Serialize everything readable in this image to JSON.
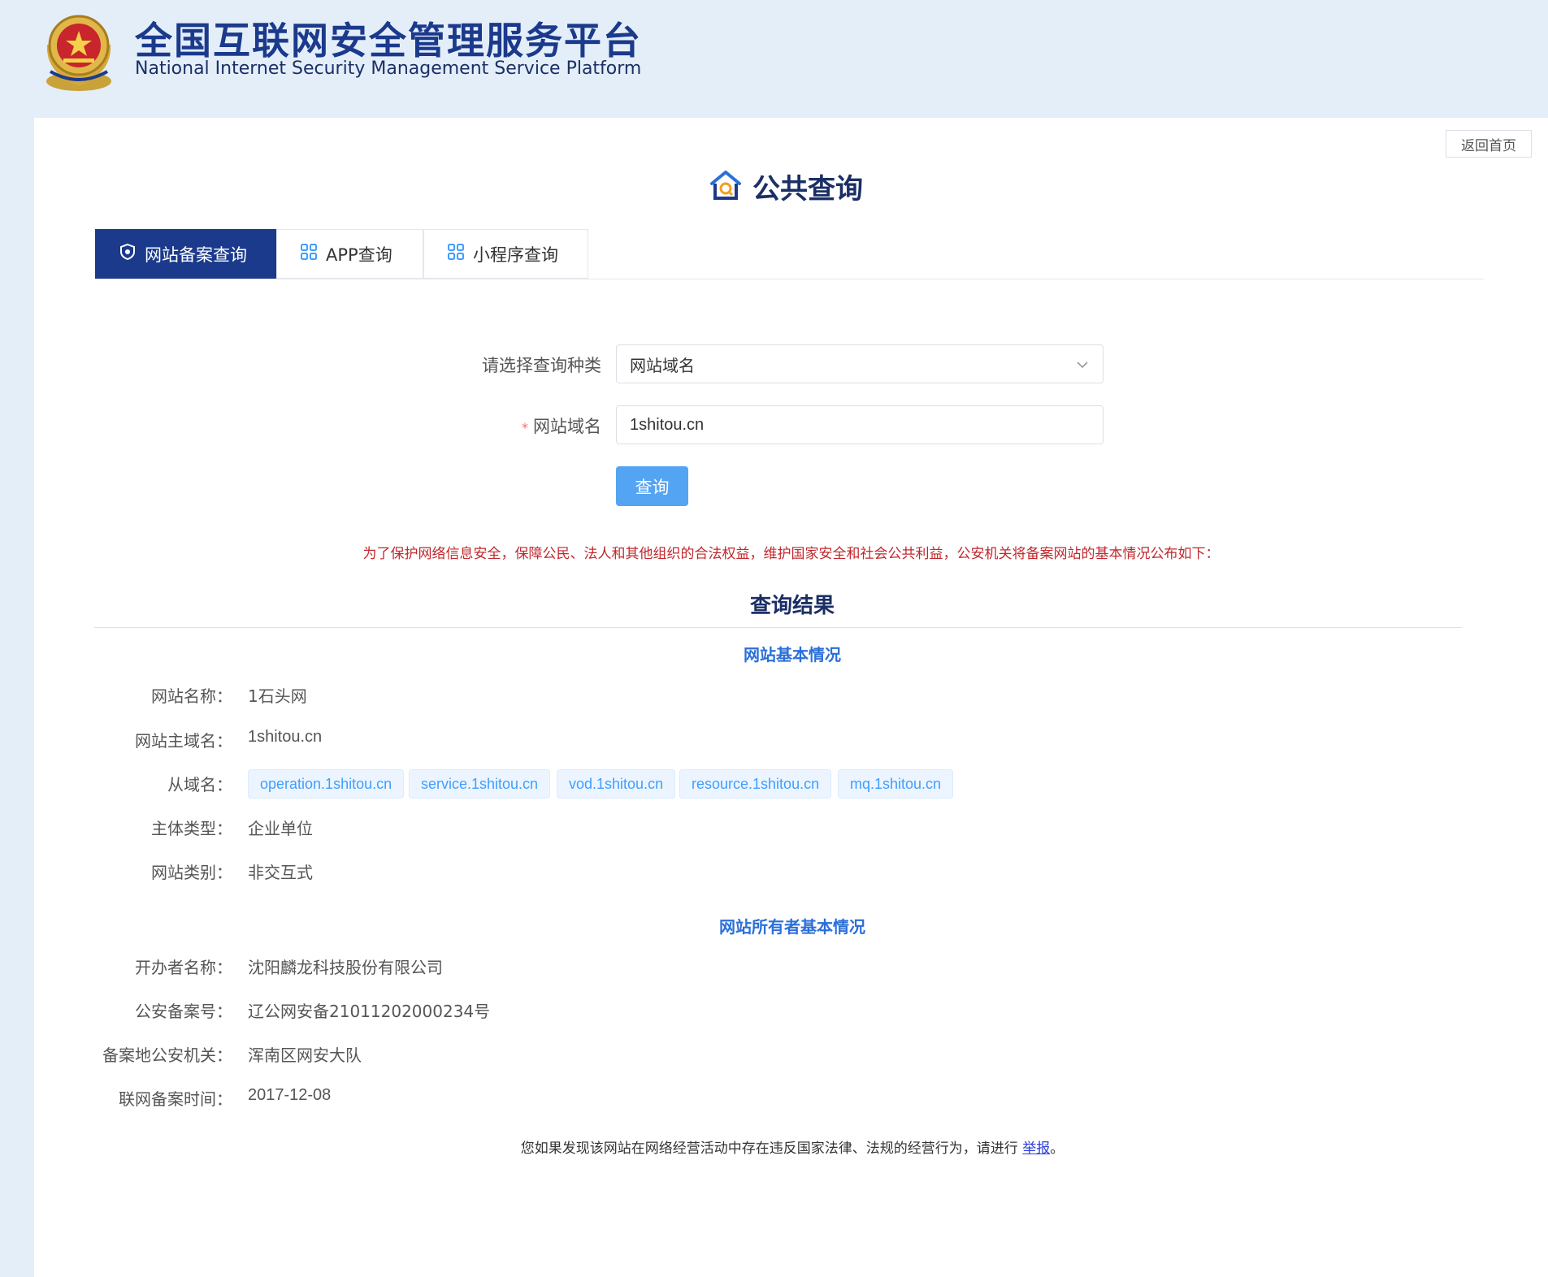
{
  "header": {
    "title_cn": "全国互联网安全管理服务平台",
    "title_en": "National Internet Security Management Service Platform"
  },
  "toolbar": {
    "home_label": "返回首页"
  },
  "page": {
    "title": "公共查询"
  },
  "tabs": [
    {
      "label": "网站备案查询",
      "icon": "shield-icon",
      "active": true
    },
    {
      "label": "APP查询",
      "icon": "grid-icon",
      "active": false
    },
    {
      "label": "小程序查询",
      "icon": "grid-icon",
      "active": false
    }
  ],
  "form": {
    "type_label": "请选择查询种类",
    "type_value": "网站域名",
    "domain_label": "网站域名",
    "required_mark": "*",
    "domain_value": "1shitou.cn",
    "submit_label": "查询"
  },
  "notice": "为了保护网络信息安全，保障公民、法人和其他组织的合法权益，维护国家安全和社会公共利益，公安机关将备案网站的基本情况公布如下：",
  "result": {
    "title": "查询结果",
    "basic_section_title": "网站基本情况",
    "site_name_label": "网站名称：",
    "site_name": "1石头网",
    "main_domain_label": "网站主域名：",
    "main_domain": "1shitou.cn",
    "sub_domains_label": "从域名：",
    "sub_domains": [
      "operation.1shitou.cn",
      "service.1shitou.cn",
      "vod.1shitou.cn",
      "resource.1shitou.cn",
      "mq.1shitou.cn"
    ],
    "entity_type_label": "主体类型：",
    "entity_type": "企业单位",
    "site_category_label": "网站类别：",
    "site_category": "非交互式",
    "owner_section_title": "网站所有者基本情况",
    "organizer_label": "开办者名称：",
    "organizer": "沈阳麟龙科技股份有限公司",
    "record_no_label": "公安备案号：",
    "record_no": "辽公网安备21011202000234号",
    "authority_label": "备案地公安机关：",
    "authority": "浑南区网安大队",
    "record_time_label": "联网备案时间：",
    "record_time": "2017-12-08"
  },
  "report": {
    "prefix": "您如果发现该网站在网络经营活动中存在违反国家法律、法规的经营行为，请进行 ",
    "link": "举报",
    "suffix": "。"
  },
  "colors": {
    "header_bg": "#e4eef9",
    "brand": "#1b3a8c",
    "accent": "#409eff",
    "button": "#53a4f3",
    "notice": "#c0282d",
    "section": "#2b6fd9"
  }
}
